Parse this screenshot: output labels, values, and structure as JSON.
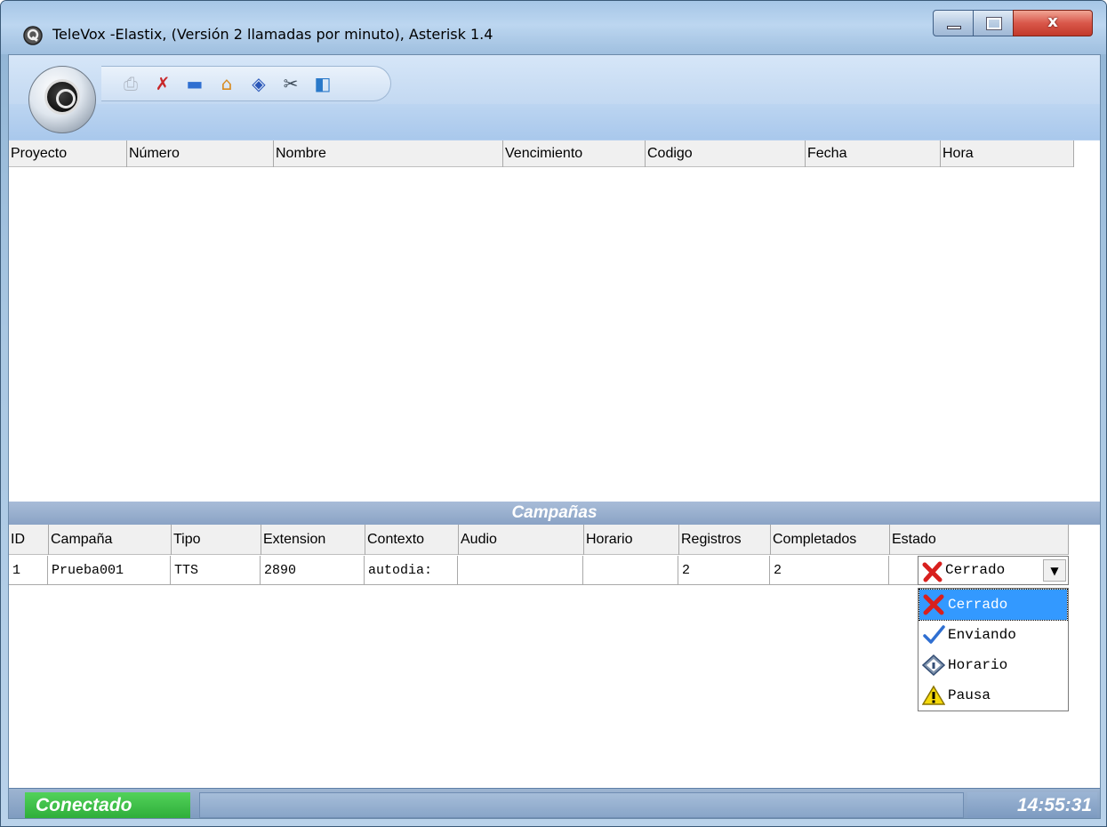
{
  "window": {
    "title": "TeleVox -Elastix, (Versión 2 llamadas por minuto), Asterisk 1.4",
    "controls": {
      "minimize": "minimize",
      "maximize": "maximize",
      "close": "x"
    }
  },
  "toolbar": {
    "logo": "televox-logo-icon",
    "buttons": [
      {
        "name": "print-icon",
        "glyph": "⎙",
        "color": "#b0b8c4"
      },
      {
        "name": "disconnect-icon",
        "glyph": "✗",
        "color": "#c8282a"
      },
      {
        "name": "monitor-icon",
        "glyph": "▬",
        "color": "#2f6fd1"
      },
      {
        "name": "home-icon",
        "glyph": "⌂",
        "color": "#d88a1e"
      },
      {
        "name": "schedule-icon",
        "glyph": "◈",
        "color": "#2b57b8"
      },
      {
        "name": "tools-icon",
        "glyph": "✂",
        "color": "#3c4a58"
      },
      {
        "name": "exit-icon",
        "glyph": "◧",
        "color": "#2a79c9"
      }
    ]
  },
  "projects_table": {
    "columns": [
      "Proyecto",
      "Número",
      "Nombre",
      "Vencimiento",
      "Codigo",
      "Fecha",
      "Hora"
    ],
    "rows": []
  },
  "campaigns": {
    "title": "Campañas",
    "columns": [
      "ID",
      "Campaña",
      "Tipo",
      "Extension",
      "Contexto",
      "Audio",
      "Horario",
      "Registros",
      "Completados",
      "Estado"
    ],
    "rows": [
      {
        "id": "1",
        "campana": "Prueba001",
        "tipo": "TTS",
        "extension": "2890",
        "contexto": "autodia:",
        "audio": "",
        "horario": "",
        "registros": "2",
        "completados": "2",
        "estado": "Cerrado"
      }
    ],
    "estado_options": [
      {
        "label": "Cerrado",
        "icon": "close-x-icon",
        "selected": true
      },
      {
        "label": "Enviando",
        "icon": "checkmark-icon",
        "selected": false
      },
      {
        "label": "Horario",
        "icon": "diamond-info-icon",
        "selected": false
      },
      {
        "label": "Pausa",
        "icon": "warning-icon",
        "selected": false
      }
    ]
  },
  "statusbar": {
    "connection": "Conectado",
    "time": "14:55:31"
  },
  "colors": {
    "connected": "#2fae3a",
    "selection": "#3399ff",
    "close_x": "#d8201e"
  }
}
